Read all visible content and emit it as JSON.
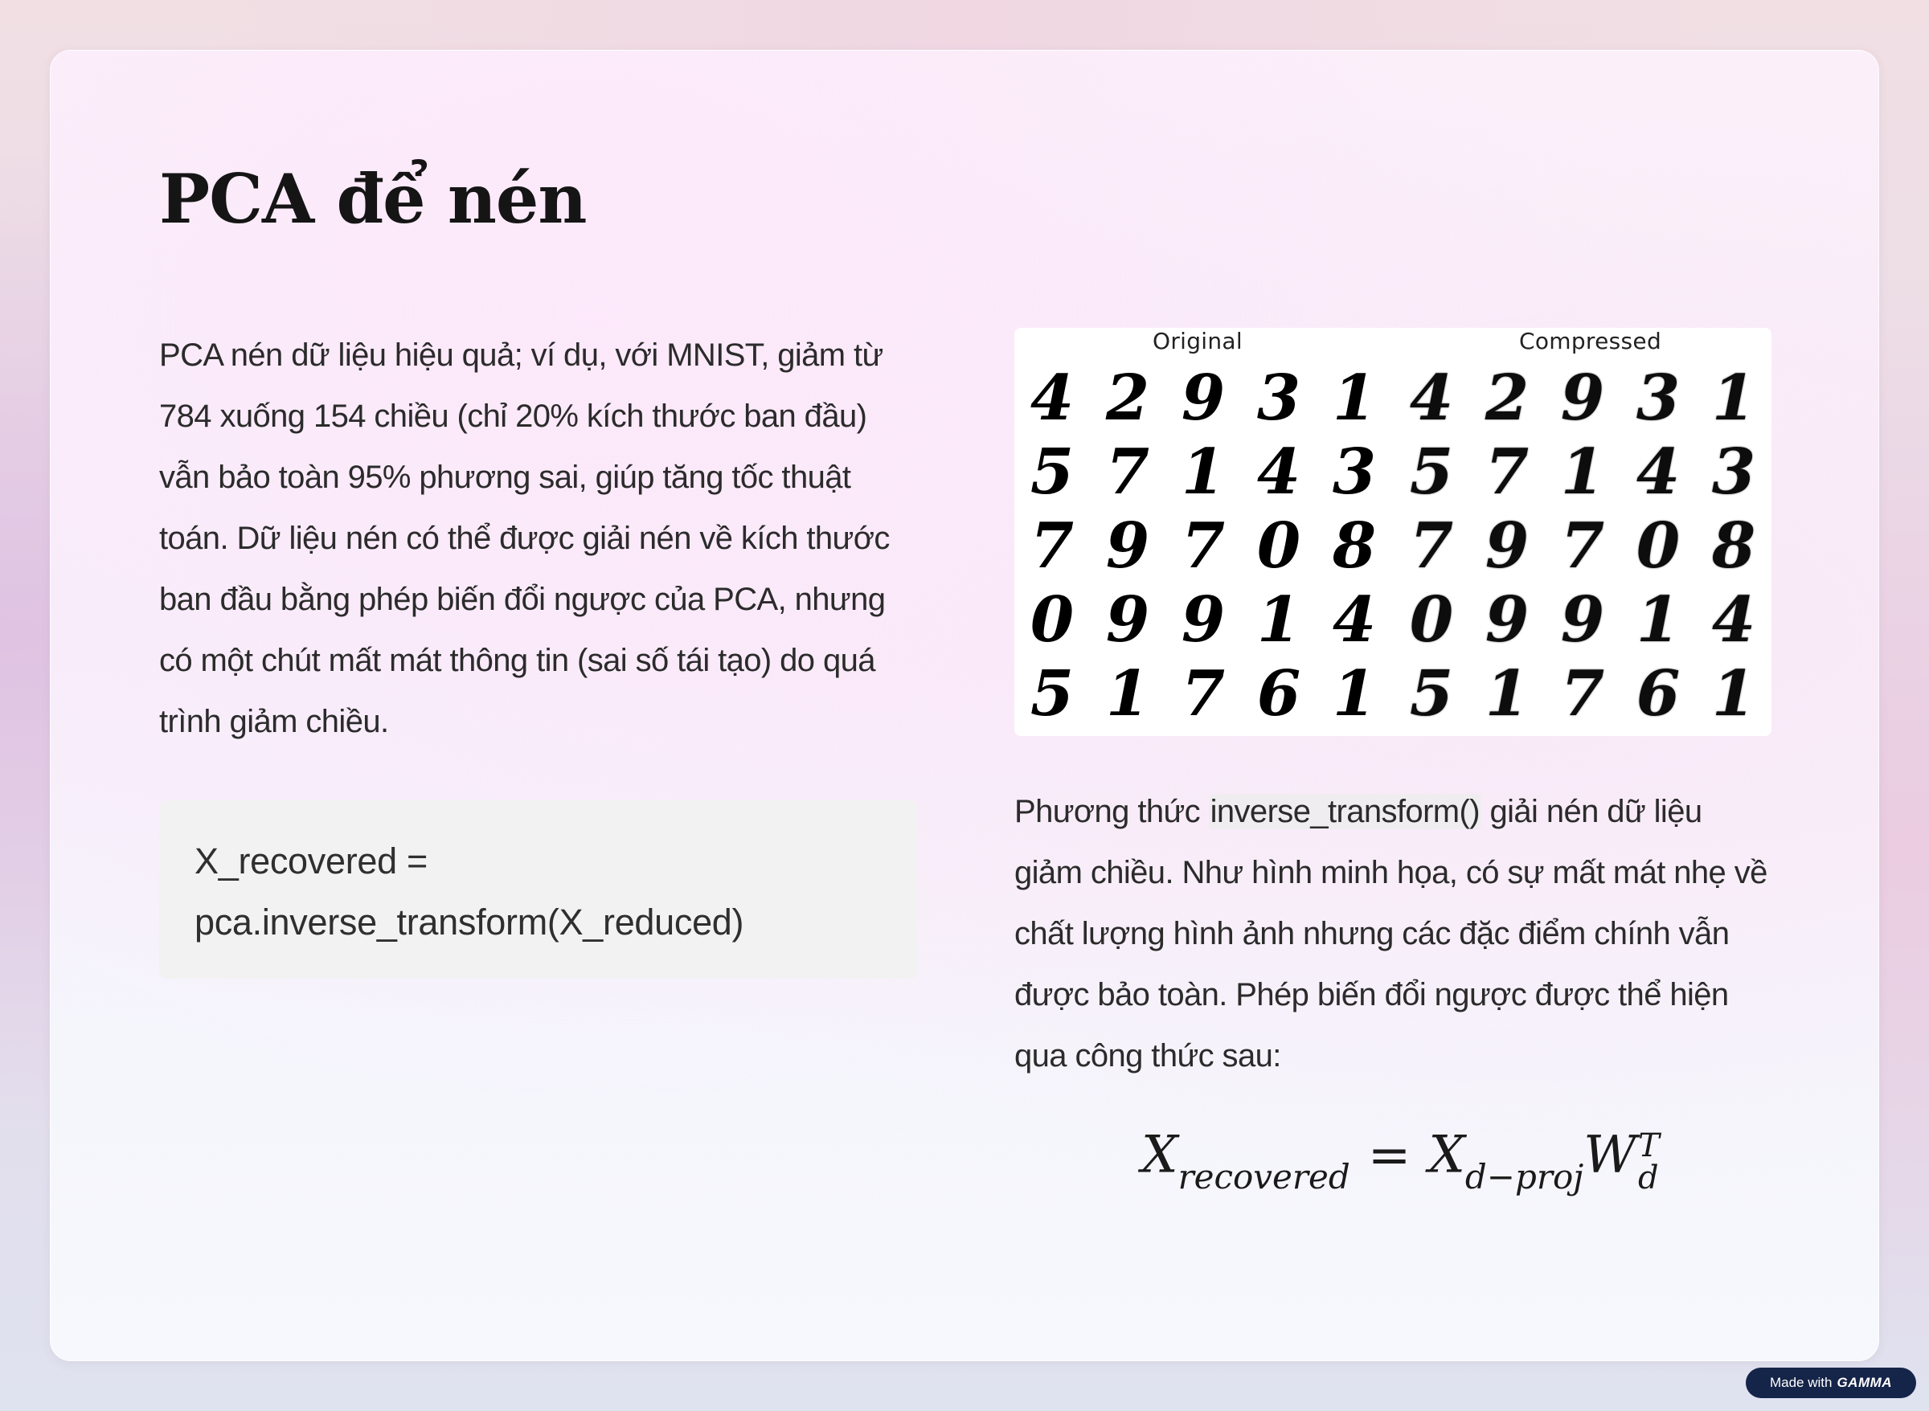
{
  "slide": {
    "title": "PCA để nén",
    "left_paragraph": "PCA nén dữ liệu hiệu quả; ví dụ, với MNIST, giảm từ 784 xuống 154 chiều (chỉ 20% kích thước ban đầu) vẫn bảo toàn 95% phương sai, giúp tăng tốc thuật toán. Dữ liệu nén có thể được giải nén về kích thước ban đầu bằng phép biến đổi ngược của PCA, nhưng có một chút mất mát thông tin (sai số tái tạo) do quá trình giảm chiều.",
    "code_line_1": "X_recovered =",
    "code_line_2": "pca.inverse_transform(X_reduced)",
    "right_paragraph": {
      "before_code": "Phương thức ",
      "inline_code": "inverse_transform()",
      "after_code": " giải nén dữ liệu giảm chiều. Như hình minh họa, có sự mất mát nhẹ về chất lượng hình ảnh nhưng các đặc điểm chính vẫn được bảo toàn. Phép biến đổi ngược được thể hiện qua công thức sau:"
    },
    "formula": {
      "lhs": "X",
      "lhs_sub": "recovered",
      "equals": "=",
      "rhs_1": "X",
      "rhs_1_sub": "d−proj",
      "rhs_2": "W",
      "rhs_2_sup": "T",
      "rhs_2_sub": "d"
    }
  },
  "figure": {
    "label_original": "Original",
    "label_compressed": "Compressed",
    "digits": [
      [
        "4",
        "2",
        "9",
        "3",
        "1"
      ],
      [
        "5",
        "7",
        "1",
        "4",
        "3"
      ],
      [
        "7",
        "9",
        "7",
        "0",
        "8"
      ],
      [
        "0",
        "9",
        "9",
        "1",
        "4"
      ],
      [
        "5",
        "1",
        "7",
        "6",
        "1"
      ]
    ]
  },
  "badge": {
    "prefix": "Made with",
    "brand": "GAMMA"
  }
}
